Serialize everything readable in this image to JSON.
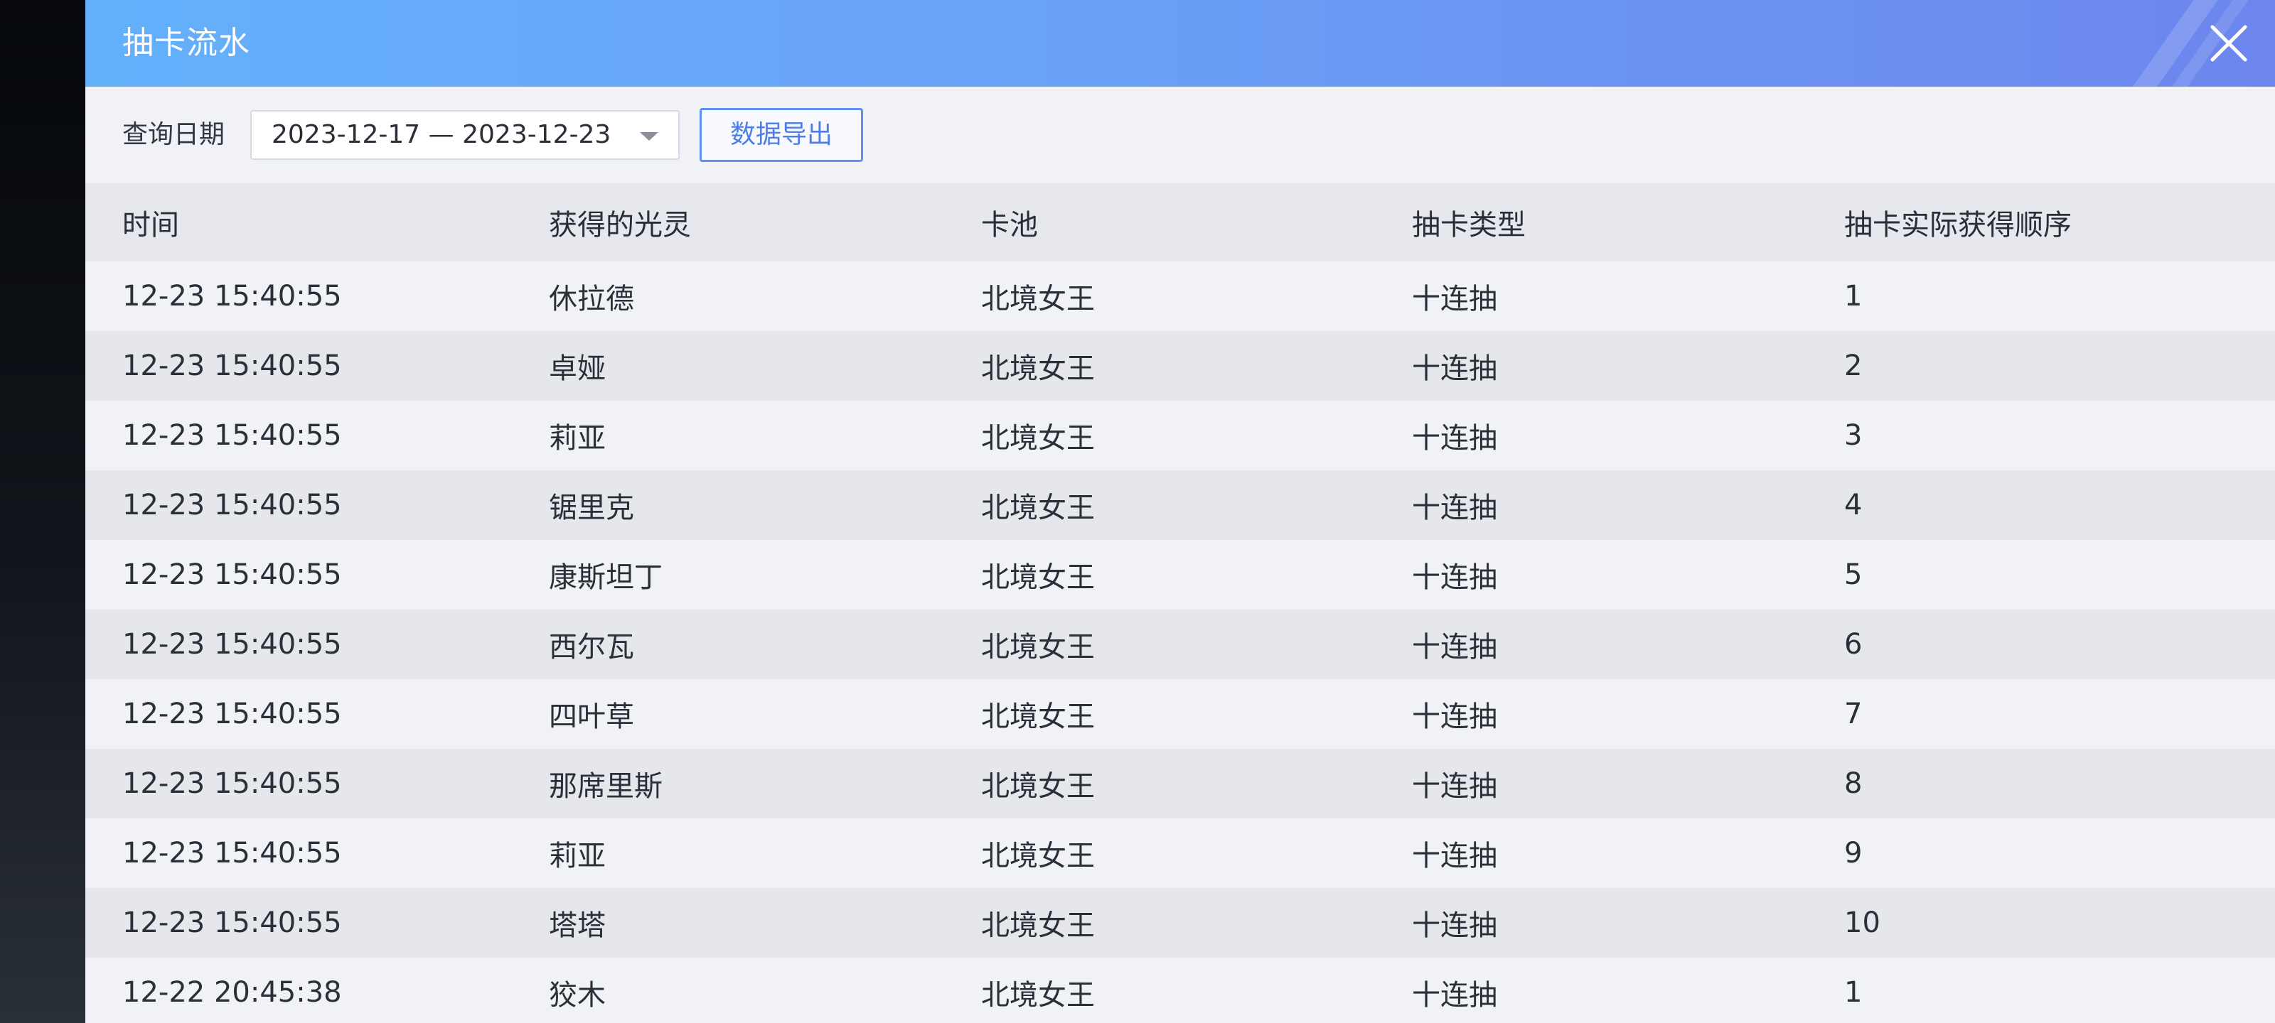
{
  "window": {
    "title": "抽卡流水",
    "close_icon": "close-icon"
  },
  "filter": {
    "label": "查询日期",
    "date_range": "2023-12-17 — 2023-12-23",
    "dropdown_icon": "caret-down-icon",
    "export_label": "数据导出"
  },
  "table": {
    "columns": [
      "时间",
      "获得的光灵",
      "卡池",
      "抽卡类型",
      "抽卡实际获得顺序"
    ],
    "rows": [
      [
        "12-23 15:40:55",
        "休拉德",
        "北境女王",
        "十连抽",
        "1"
      ],
      [
        "12-23 15:40:55",
        "卓娅",
        "北境女王",
        "十连抽",
        "2"
      ],
      [
        "12-23 15:40:55",
        "莉亚",
        "北境女王",
        "十连抽",
        "3"
      ],
      [
        "12-23 15:40:55",
        "锯里克",
        "北境女王",
        "十连抽",
        "4"
      ],
      [
        "12-23 15:40:55",
        "康斯坦丁",
        "北境女王",
        "十连抽",
        "5"
      ],
      [
        "12-23 15:40:55",
        "西尔瓦",
        "北境女王",
        "十连抽",
        "6"
      ],
      [
        "12-23 15:40:55",
        "四叶草",
        "北境女王",
        "十连抽",
        "7"
      ],
      [
        "12-23 15:40:55",
        "那席里斯",
        "北境女王",
        "十连抽",
        "8"
      ],
      [
        "12-23 15:40:55",
        "莉亚",
        "北境女王",
        "十连抽",
        "9"
      ],
      [
        "12-23 15:40:55",
        "塔塔",
        "北境女王",
        "十连抽",
        "10"
      ],
      [
        "12-22 20:45:38",
        "狡木",
        "北境女王",
        "十连抽",
        "1"
      ]
    ]
  },
  "colors": {
    "header_gradient_start": "#63b0fb",
    "header_gradient_end": "#6c86ee",
    "accent": "#4d7ee8"
  }
}
